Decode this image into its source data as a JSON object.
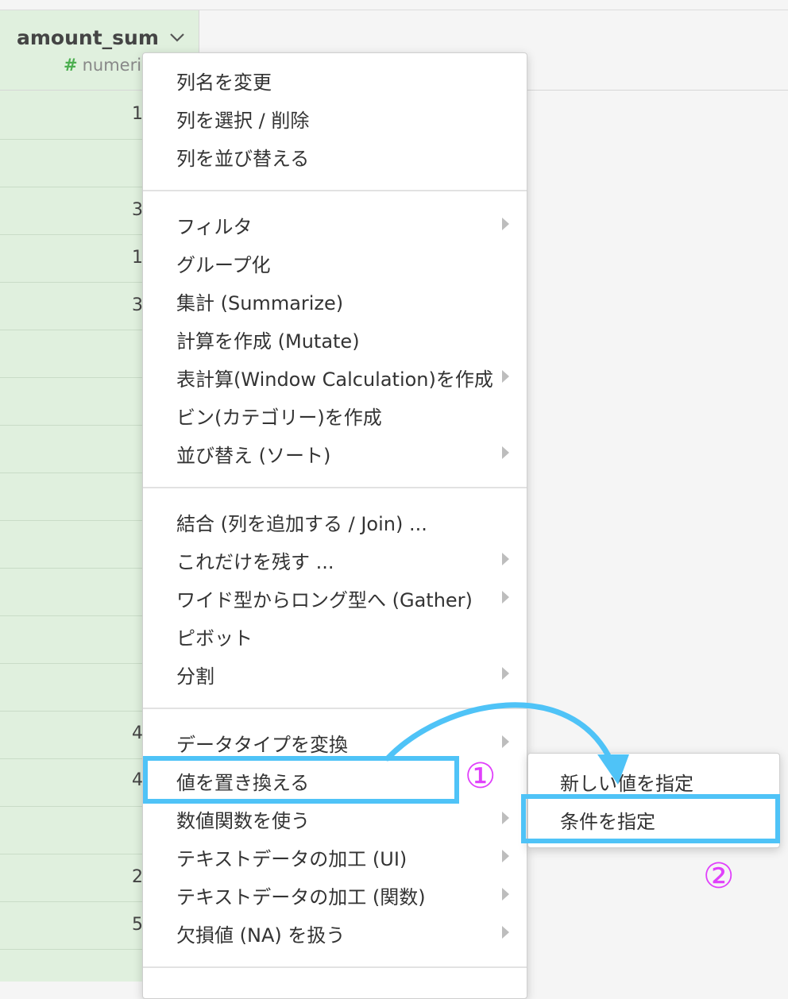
{
  "column": {
    "name": "amount_sum",
    "type_icon": "#",
    "type_label": "numeric",
    "visible_cells": [
      "1",
      "3",
      "1",
      "3",
      "4",
      "4",
      "2",
      "5"
    ]
  },
  "menu": {
    "group1": [
      {
        "label": "列名を変更",
        "submenu": false
      },
      {
        "label": "列を選択 / 削除",
        "submenu": false
      },
      {
        "label": "列を並び替える",
        "submenu": false
      }
    ],
    "group2": [
      {
        "label": "フィルタ",
        "submenu": true
      },
      {
        "label": "グループ化",
        "submenu": false
      },
      {
        "label": "集計 (Summarize)",
        "submenu": false
      },
      {
        "label": "計算を作成 (Mutate)",
        "submenu": false
      },
      {
        "label": "表計算(Window Calculation)を作成",
        "submenu": true
      },
      {
        "label": "ビン(カテゴリー)を作成",
        "submenu": false
      },
      {
        "label": "並び替え (ソート)",
        "submenu": true
      }
    ],
    "group3": [
      {
        "label": "結合 (列を追加する / Join) ...",
        "submenu": false
      },
      {
        "label": "これだけを残す ...",
        "submenu": true
      },
      {
        "label": "ワイド型からロング型へ (Gather)",
        "submenu": true
      },
      {
        "label": "ピボット",
        "submenu": false
      },
      {
        "label": "分割",
        "submenu": true
      }
    ],
    "group4": [
      {
        "label": "データタイプを変換",
        "submenu": true
      },
      {
        "label": "値を置き換える",
        "submenu": true
      },
      {
        "label": "数値関数を使う",
        "submenu": true
      },
      {
        "label": "テキストデータの加工 (UI)",
        "submenu": true
      },
      {
        "label": "テキストデータの加工 (関数)",
        "submenu": true
      },
      {
        "label": "欠損値 (NA) を扱う",
        "submenu": true
      }
    ]
  },
  "submenu": {
    "items": [
      {
        "label": "新しい値を指定"
      },
      {
        "label": "条件を指定"
      }
    ]
  },
  "annotations": {
    "step1": "①",
    "step2": "②",
    "highlight_color": "#4fc3f7",
    "marker_color": "#e040fb"
  }
}
